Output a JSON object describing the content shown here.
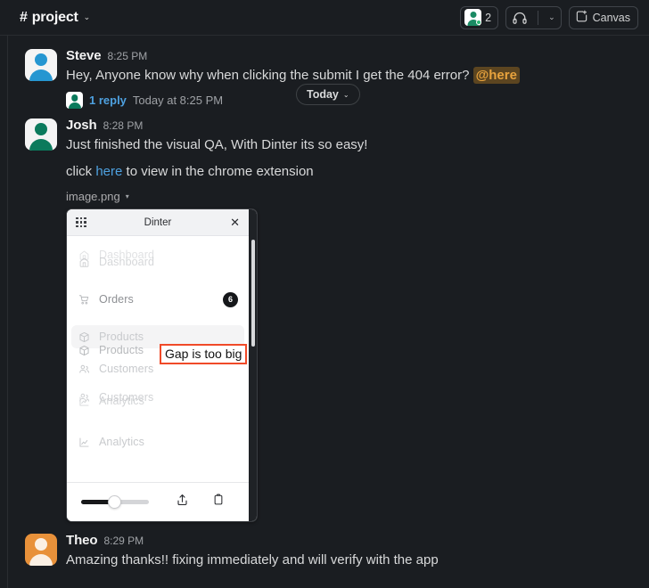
{
  "header": {
    "channel_prefix": "#",
    "channel_name": "project",
    "channel_chevron": "⌄",
    "members_count": "2",
    "members_icon": "members-icon",
    "huddle_icon": "headphones-icon",
    "huddle_chevron": "⌄",
    "canvas_label": "Canvas",
    "canvas_icon": "canvas-icon"
  },
  "divider": {
    "label": "Today",
    "chevron": "⌄"
  },
  "messages": [
    {
      "author": "Steve",
      "time": "8:25 PM",
      "avatar_color": "#2596d1",
      "text_before": "Hey, Anyone know why when clicking the submit I get the 404 error? ",
      "mention": "@here",
      "thread": {
        "reply_count": "1 reply",
        "reply_time": "Today at 8:25 PM"
      }
    },
    {
      "author": "Josh",
      "time": "8:28 PM",
      "avatar_color": "#0b7a5c",
      "line1": "Just finished the visual QA, With Dinter its so easy!",
      "line2_before": "click ",
      "line2_link": "here",
      "line2_after": " to view in the chrome extension",
      "filename": "image.png",
      "filename_caret": "▾"
    },
    {
      "author": "Theo",
      "time": "8:29 PM",
      "avatar_color": "#e8913a",
      "text": "Amazing thanks!! fixing immediately and will verify with the app"
    }
  ],
  "attachment": {
    "panel_title": "Dinter",
    "grid_icon": "app-grid-icon",
    "close_icon": "close-icon",
    "nav_items": [
      {
        "label": "Dashboard",
        "icon": "home-icon",
        "badge": ""
      },
      {
        "label": "Dashboard",
        "icon": "home-icon",
        "badge": ""
      },
      {
        "label": "Orders",
        "icon": "cart-icon",
        "badge": "6"
      },
      {
        "label": "Products",
        "icon": "box-icon",
        "badge": ""
      },
      {
        "label": "Products",
        "icon": "box-icon",
        "badge": ""
      },
      {
        "label": "Customers",
        "icon": "people-icon",
        "badge": ""
      },
      {
        "label": "Customers",
        "icon": "people-icon",
        "badge": ""
      },
      {
        "label": "Analytics",
        "icon": "chart-icon",
        "badge": ""
      },
      {
        "label": "Analytics",
        "icon": "chart-icon",
        "badge": ""
      }
    ],
    "annotation": {
      "text": "Gap is too big",
      "border_color": "#f04a28"
    },
    "footer": {
      "slider_name": "opacity-slider",
      "share_icon": "share-upload-icon",
      "copy_icon": "clipboard-icon"
    }
  },
  "colors": {
    "background": "#1a1d21",
    "link": "#4ea1e0",
    "mention_bg": "#5c4520",
    "mention_fg": "#e8a33d",
    "accent_orange": "#f04a28"
  }
}
